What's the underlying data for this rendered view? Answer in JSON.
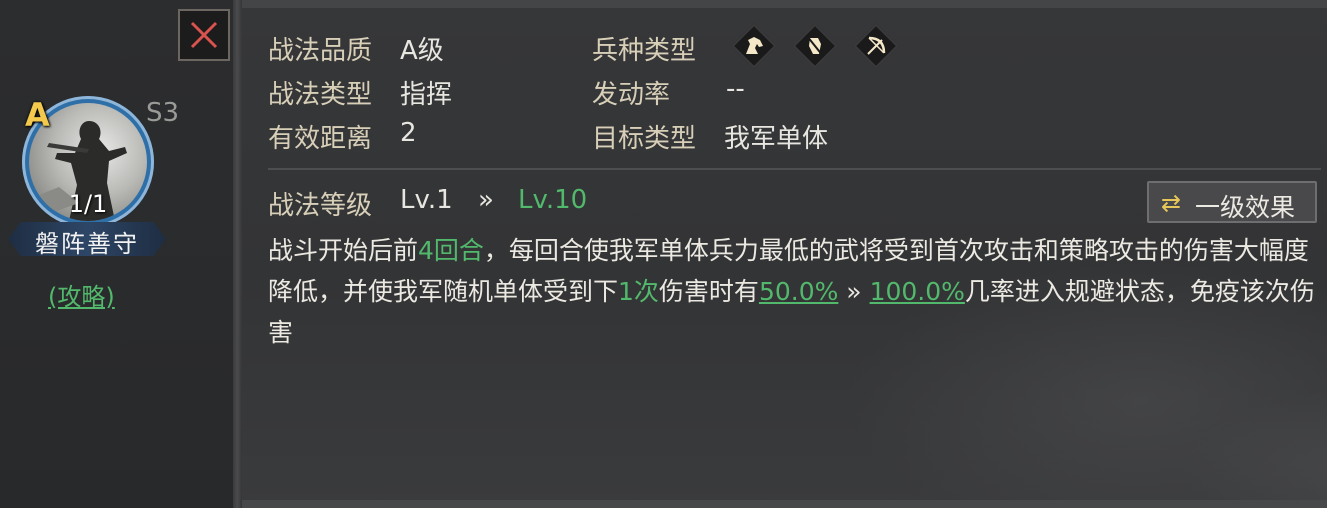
{
  "close": {
    "icon": "close-icon"
  },
  "skill": {
    "grade": "A",
    "season": "S3",
    "count": "1/1",
    "name": "磐阵善守",
    "guide": "(攻略)"
  },
  "info": {
    "quality_label": "战法品质",
    "quality_value": "A级",
    "type_label": "战法类型",
    "type_value": "指挥",
    "range_label": "有效距离",
    "range_value": "2",
    "troop_label": "兵种类型",
    "troop_icons": [
      "cavalry-icon",
      "shield-icon",
      "bow-icon"
    ],
    "rate_label": "发动率",
    "rate_value": "--",
    "target_label": "目标类型",
    "target_value": "我军单体"
  },
  "level": {
    "label": "战法等级",
    "from": "Lv.1",
    "arrow": "»",
    "to": "Lv.10",
    "button_icon": "⇄",
    "button_label": "一级效果"
  },
  "description": {
    "p1": "战斗开始后前",
    "h1": "4回合",
    "p2": "，每回合使我军单体兵力最低的武将受到首次攻击和策略攻击的伤害大幅度降低，并使我军随机单体受到下",
    "h2": "1次",
    "p3": "伤害时有",
    "u1": "50.0%",
    "arrow": " » ",
    "u2": "100.0%",
    "p4": "几率进入规避状态，免疫该次伤害"
  },
  "colors": {
    "accent_green": "#52b96c",
    "grade_gold": "#f2c94c",
    "label": "#d8cfb8"
  }
}
